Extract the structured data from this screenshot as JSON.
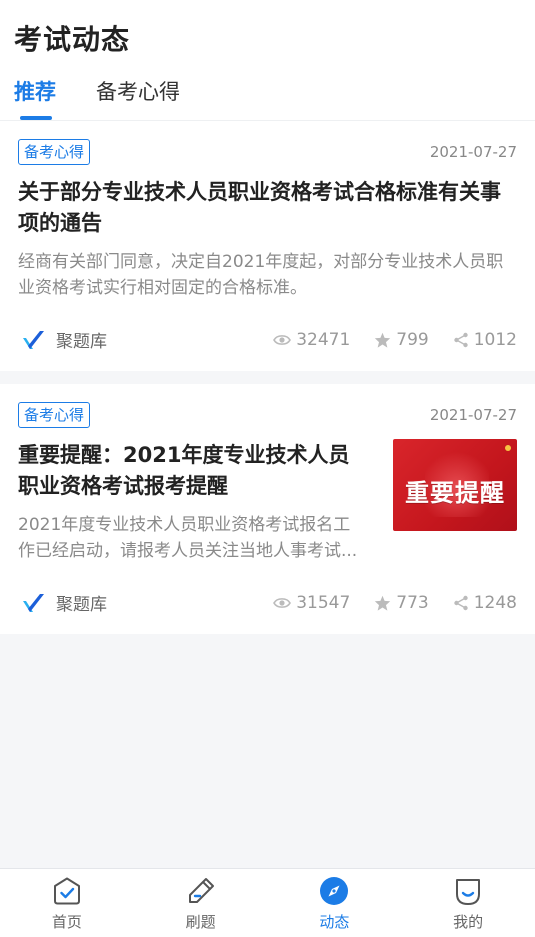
{
  "header": {
    "title": "考试动态",
    "tabs": [
      {
        "label": "推荐",
        "active": true
      },
      {
        "label": "备考心得",
        "active": false
      }
    ]
  },
  "articles": [
    {
      "tag": "备考心得",
      "date": "2021-07-27",
      "title": "关于部分专业技术人员职业资格考试合格标准有关事项的通告",
      "description": "经商有关部门同意，决定自2021年度起，对部分专业技术人员职业资格考试实行相对固定的合格标准。",
      "source": "聚题库",
      "views": "32471",
      "stars": "799",
      "shares": "1012"
    },
    {
      "tag": "备考心得",
      "date": "2021-07-27",
      "title": "重要提醒：2021年度专业技术人员职业资格考试报考提醒",
      "description": "2021年度专业技术人员职业资格考试报名工作已经启动，请报考人员关注当地人事考试...",
      "source": "聚题库",
      "views": "31547",
      "stars": "773",
      "shares": "1248",
      "thumbnail_text": "重要提醒"
    }
  ],
  "bottom_nav": [
    {
      "label": "首页",
      "icon": "home-check-icon",
      "active": false
    },
    {
      "label": "刷题",
      "icon": "pencil-icon",
      "active": false
    },
    {
      "label": "动态",
      "icon": "compass-icon",
      "active": true
    },
    {
      "label": "我的",
      "icon": "profile-icon",
      "active": false
    }
  ],
  "colors": {
    "accent": "#1c7ce6",
    "background": "#f5f6f8",
    "muted_text": "#8a8a8a"
  }
}
